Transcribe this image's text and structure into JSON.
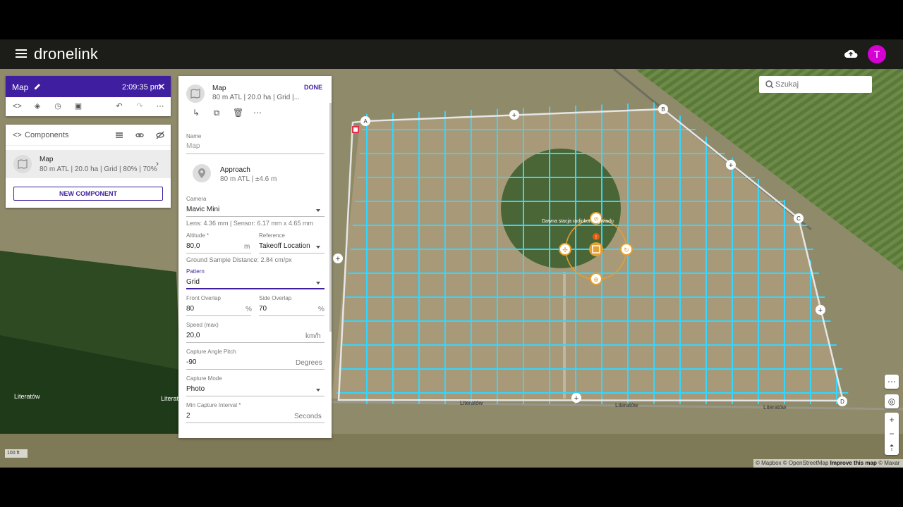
{
  "app": {
    "logo": "dronelink",
    "avatar_letter": "T"
  },
  "search": {
    "placeholder": "Szukaj"
  },
  "map_panel": {
    "title": "Map",
    "time": "2:09:35 pm"
  },
  "components": {
    "header": "Components",
    "item": {
      "name": "Map",
      "summary": "80 m ATL | 20.0 ha | Grid | 80% | 70%"
    },
    "new_button": "NEW COMPONENT"
  },
  "editor": {
    "title": "Map",
    "subtitle": "80 m ATL | 20.0 ha | Grid |...",
    "done": "DONE",
    "name": {
      "label": "Name",
      "placeholder": "Map"
    },
    "approach": {
      "title": "Approach",
      "subtitle": "80 m ATL | ±4.6 m"
    },
    "camera": {
      "label": "Camera",
      "value": "Mavic Mini",
      "lens_info": "Lens: 4.36 mm | Sensor: 6.17 mm x 4.65 mm"
    },
    "altitude": {
      "label": "Altitude *",
      "value": "80,0",
      "unit": "m"
    },
    "reference": {
      "label": "Reference",
      "value": "Takeoff Location"
    },
    "gsd": "Ground Sample Distance: 2.84 cm/px",
    "pattern": {
      "label": "Pattern",
      "value": "Grid"
    },
    "front_overlap": {
      "label": "Front Overlap",
      "value": "80",
      "unit": "%"
    },
    "side_overlap": {
      "label": "Side Overlap",
      "value": "70",
      "unit": "%"
    },
    "speed": {
      "label": "Speed (max)",
      "value": "20,0",
      "unit": "km/h"
    },
    "pitch": {
      "label": "Capture Angle Pitch",
      "value": "-90",
      "unit": "Degrees"
    },
    "capture_mode": {
      "label": "Capture Mode",
      "value": "Photo"
    },
    "interval": {
      "label": "Min Capture Interval *",
      "value": "2",
      "unit": "Seconds"
    }
  },
  "map": {
    "labels": {
      "place1": "Literatów",
      "place2": "Literat",
      "road1": "Literatów",
      "road2": "Literatów",
      "road3": "Literatów",
      "poi": "Dawna stacja radiokontrwywiadu"
    },
    "vertices": [
      "A",
      "B",
      "C",
      "D"
    ],
    "scale": "100 ft",
    "attribution_a": "© Mapbox © OpenStreetMap ",
    "attribution_b": "Improve this map",
    "attribution_c": " © Maxar",
    "grid_color": "#33d6ff"
  }
}
